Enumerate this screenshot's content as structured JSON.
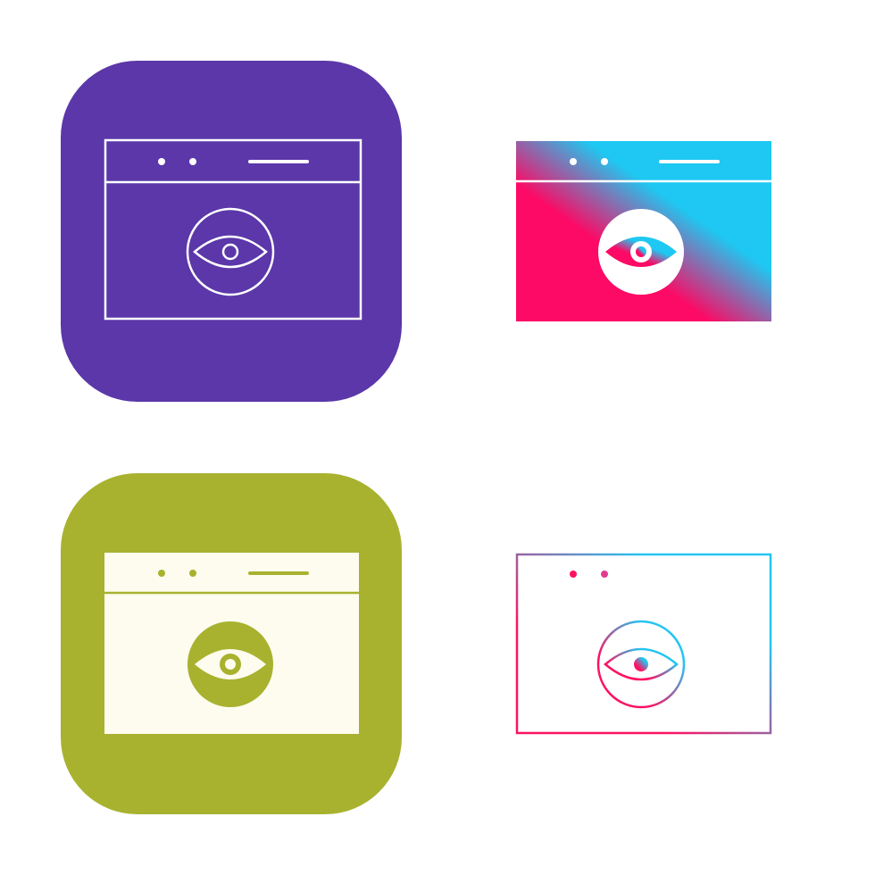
{
  "icons": [
    {
      "name": "browser-eye-icon",
      "style": "line",
      "background": "rounded-square",
      "background_color": "#5b37a9",
      "stroke_color": "#ffffff"
    },
    {
      "name": "browser-eye-icon",
      "style": "gradient-solid",
      "gradient": [
        "#fc0a65",
        "#1ec8f2"
      ]
    },
    {
      "name": "browser-eye-icon",
      "style": "glyph",
      "background": "rounded-square",
      "background_color": "#a8b22f",
      "fill_color": "#fefcef"
    },
    {
      "name": "browser-eye-icon",
      "style": "gradient-line",
      "gradient": [
        "#fd1263",
        "#24c5f1"
      ]
    }
  ]
}
